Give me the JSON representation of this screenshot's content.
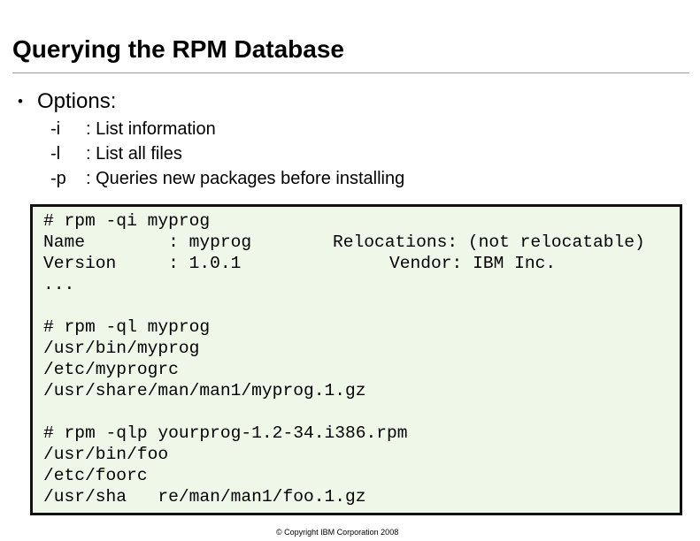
{
  "slide": {
    "title": "Querying the RPM Database",
    "bullet_symbol": "•",
    "bullet_label": "Options:",
    "options": [
      {
        "flag": "-i",
        "desc": ": List information"
      },
      {
        "flag": "-l",
        "desc": ": List all files"
      },
      {
        "flag": "-p",
        "desc": ": Queries new packages before installing"
      }
    ]
  },
  "code": {
    "block1": {
      "cmd": "# rpm -qi myprog",
      "name_row": "Name        : myprog",
      "relocations": "Relocations: (not relocatable)",
      "version_row": "Version     : 1.0.1",
      "vendor": "Vendor: IBM Inc.",
      "ellipsis": "..."
    },
    "block2": [
      "# rpm -ql myprog",
      "/usr/bin/myprog",
      "/etc/myprogrc",
      "/usr/share/man/man1/myprog.1.gz"
    ],
    "block3": [
      "# rpm -qlp yourprog-1.2-34.i386.rpm",
      "/usr/bin/foo",
      "/etc/foorc",
      "/usr/sha   re/man/man1/foo.1.gz"
    ]
  },
  "footer": "© Copyright IBM Corporation 2008"
}
